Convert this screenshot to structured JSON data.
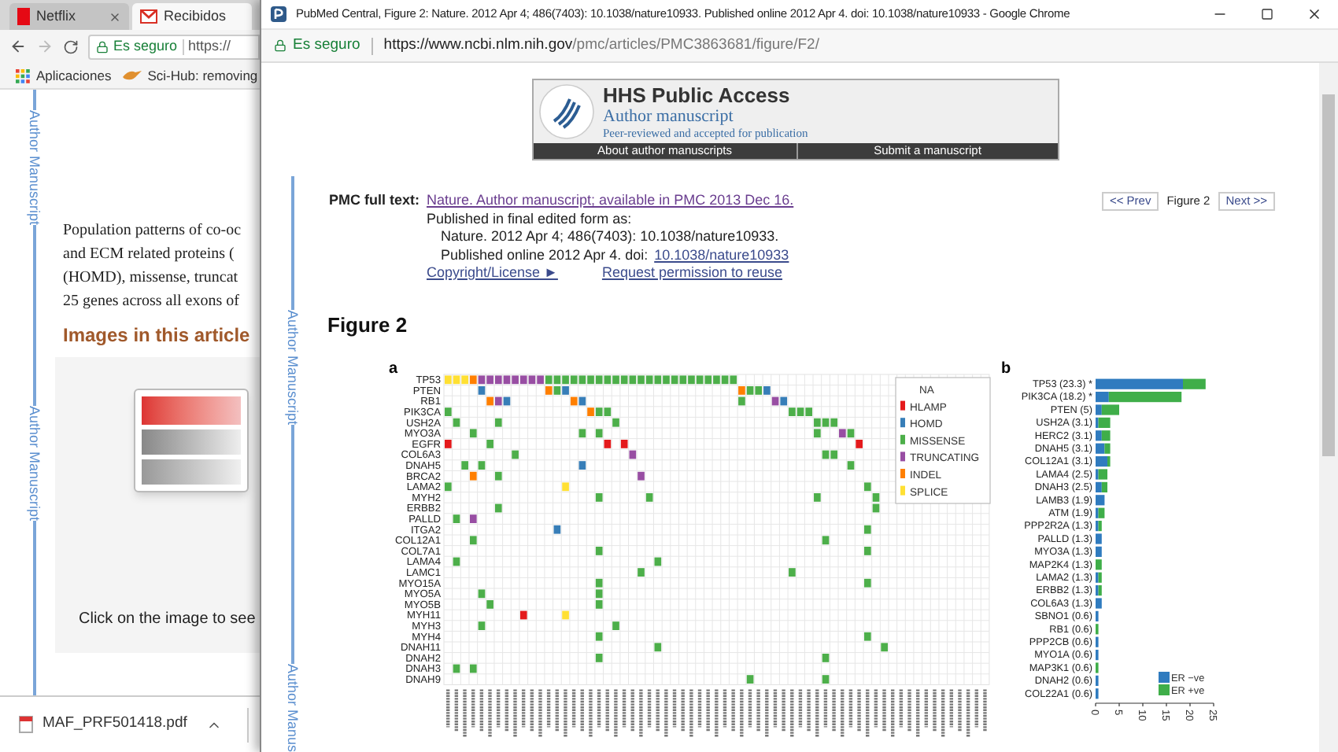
{
  "back_window": {
    "tabs": [
      {
        "label": "Netflix",
        "kind": "video",
        "selected": false,
        "closable": true
      },
      {
        "label": "Recibidos",
        "kind": "mail",
        "selected": true,
        "closable": false
      }
    ],
    "security": "Es seguro",
    "url": "https://",
    "bookmarks": [
      {
        "label": "Aplicaciones",
        "kind": "apps"
      },
      {
        "label": "Sci-Hub: removing",
        "kind": "site"
      }
    ],
    "side_labels": [
      "Author Manuscript",
      "Author Manuscript"
    ],
    "paragraph_lines": [
      "Population patterns of co-oc",
      "and ECM related proteins (",
      "(HOMD), missense, truncat",
      "25 genes across all exons of"
    ],
    "images_heading": "Images in this article",
    "thumbnail_caption": "Click on the image to see",
    "download": {
      "file": "MAF_PRF501418.pdf"
    }
  },
  "window": {
    "title": "PubMed Central, Figure 2: Nature. 2012 Apr 4; 486(7403): 10.1038/nature10933. Published online 2012 Apr 4. doi:  10.1038/nature10933 - Google Chrome",
    "security": "Es seguro",
    "url_host": "https://www.ncbi.nlm.nih.gov",
    "url_path": "/pmc/articles/PMC3863681/figure/F2/",
    "side_labels": [
      "Author Manuscript",
      "Author Manus"
    ],
    "banner": {
      "title": "HHS Public Access",
      "subtitle": "Author manuscript",
      "tagline": "Peer-reviewed and accepted for publication",
      "links": [
        "About author manuscripts",
        "Submit a manuscript"
      ]
    },
    "citation": {
      "label": "PMC full text:",
      "link": "Nature. Author manuscript; available in PMC 2013 Dec 16.",
      "published_as": "Published in final edited form as:",
      "journal": "Nature. 2012 Apr 4; 486(7403): 10.1038/nature10933.",
      "online": "Published online 2012 Apr 4. doi:",
      "doi": "10.1038/nature10933",
      "copyright": "Copyright/License ►",
      "permission": "Request permission to reuse"
    },
    "pager": {
      "prev": "<< Prev",
      "current": "Figure 2",
      "next": "Next >>"
    },
    "figure_title": "Figure 2",
    "panel_a": {
      "label": "a",
      "legend": [
        {
          "label": "NA"
        },
        {
          "label": "HLAMP",
          "color": "#e41a1c"
        },
        {
          "label": "HOMD",
          "color": "#377eb8"
        },
        {
          "label": "MISSENSE",
          "color": "#4daf4a"
        },
        {
          "label": "TRUNCATING",
          "color": "#984ea3"
        },
        {
          "label": "INDEL",
          "color": "#ff7f00"
        },
        {
          "label": "SPLICE",
          "color": "#ffe033"
        }
      ],
      "genes": [
        "TP53",
        "PTEN",
        "RB1",
        "PIK3CA",
        "USH2A",
        "MYO3A",
        "EGFR",
        "COL6A3",
        "DNAH5",
        "BRCA2",
        "LAMA2",
        "MYH2",
        "ERBB2",
        "PALLD",
        "ITGA2",
        "COL12A1",
        "COL7A1",
        "LAMA4",
        "LAMC1",
        "MYO15A",
        "MYO5A",
        "MYO5B",
        "MYH11",
        "MYH3",
        "MYH4",
        "DNAH11",
        "DNAH2",
        "DNAH3",
        "DNAH9"
      ]
    },
    "panel_b": {
      "label": "b",
      "chart_data": {
        "type": "bar",
        "orientation": "horizontal",
        "stacked": true,
        "categories": [
          "TP53 (23.3) *",
          "PIK3CA (18.2) *",
          "PTEN (5)",
          "USH2A (3.1)",
          "HERC2 (3.1)",
          "DNAH5 (3.1)",
          "COL12A1 (3.1)",
          "LAMA4 (2.5)",
          "DNAH3 (2.5)",
          "LAMB3 (1.9)",
          "ATM (1.9)",
          "PPP2R2A (1.3)",
          "PALLD (1.3)",
          "MYO3A (1.3)",
          "MAP2K4 (1.3)",
          "LAMA2 (1.3)",
          "ERBB2 (1.3)",
          "COL6A3 (1.3)",
          "SBNO1 (0.6)",
          "RB1 (0.6)",
          "PPP2CB (0.6)",
          "MYO1A (0.6)",
          "MAP3K1 (0.6)",
          "DNAH2 (0.6)",
          "COL22A1 (0.6)"
        ],
        "series": [
          {
            "name": "ER −ve",
            "color": "#2f7bbf",
            "values": [
              18.5,
              2.8,
              1.3,
              0.6,
              1.3,
              1.9,
              2.5,
              0.6,
              1.3,
              1.9,
              0.6,
              0.6,
              1.3,
              1.3,
              0,
              0.6,
              0.6,
              1.3,
              0.6,
              0,
              0.6,
              0.6,
              0,
              0.6,
              0.6
            ]
          },
          {
            "name": "ER +ve",
            "color": "#3fae49",
            "values": [
              4.8,
              15.4,
              3.7,
              2.5,
              1.8,
              1.2,
              0.6,
              1.9,
              1.2,
              0,
              1.3,
              0.7,
              0,
              0,
              1.3,
              0.7,
              0.7,
              0,
              0,
              0.6,
              0,
              0,
              0.6,
              0,
              0
            ]
          }
        ],
        "legend": "lower right",
        "xlim": [
          0,
          25
        ],
        "xticks": [
          0,
          5,
          10,
          15,
          20,
          25
        ]
      }
    }
  }
}
